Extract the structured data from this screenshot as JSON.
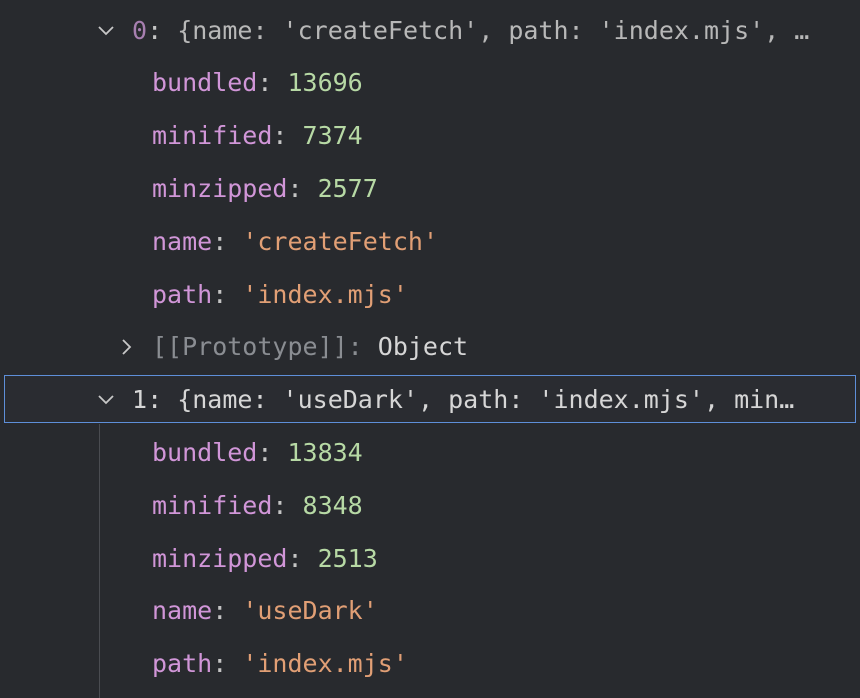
{
  "rows": [
    {
      "id": "entry-0",
      "index": "0",
      "colon": ":",
      "preview": "{name: 'createFetch', path: 'index.mjs', …",
      "expanded": true
    },
    {
      "key": "bundled",
      "value": "13696",
      "type": "number"
    },
    {
      "key": "minified",
      "value": "7374",
      "type": "number"
    },
    {
      "key": "minzipped",
      "value": "2577",
      "type": "number"
    },
    {
      "key": "name",
      "value": "'createFetch'",
      "type": "string"
    },
    {
      "key": "path",
      "value": "'index.mjs'",
      "type": "string"
    },
    {
      "key": "[[Prototype]]",
      "value": "Object",
      "type": "prototype",
      "expanded": false
    },
    {
      "id": "entry-1",
      "index": "1",
      "colon": ":",
      "preview": "{name: 'useDark', path: 'index.mjs', min…",
      "expanded": true,
      "selected": true
    },
    {
      "key": "bundled",
      "value": "13834",
      "type": "number"
    },
    {
      "key": "minified",
      "value": "8348",
      "type": "number"
    },
    {
      "key": "minzipped",
      "value": "2513",
      "type": "number"
    },
    {
      "key": "name",
      "value": "'useDark'",
      "type": "string"
    },
    {
      "key": "path",
      "value": "'index.mjs'",
      "type": "string"
    }
  ],
  "colors": {
    "background": "#282a2e",
    "key": "#d196d8",
    "number": "#b7d9a5",
    "string": "#e19f75",
    "selection_border": "#5e8fd9"
  }
}
